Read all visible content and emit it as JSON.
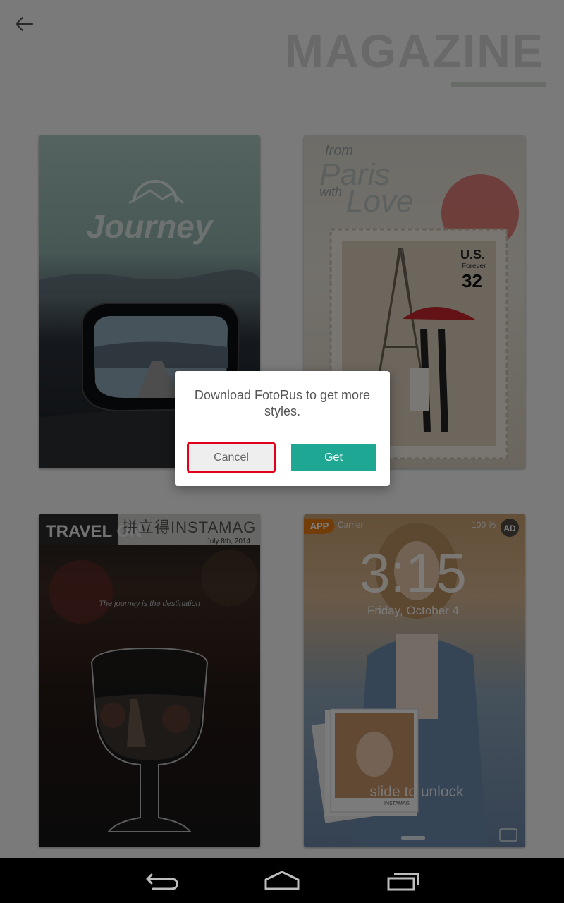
{
  "header": {
    "title": "MAGAZINE",
    "back_icon": "arrow-left-icon"
  },
  "templates": {
    "journey": {
      "title": "Journey"
    },
    "paris": {
      "from": "from",
      "paris": "Paris",
      "with": "with",
      "love": "Love",
      "stamp_country": "U.S.",
      "stamp_forever": "Forever",
      "stamp_value": "32"
    },
    "travel": {
      "title": "TRAVEL ON",
      "brand": "拼立得INSTAMAG",
      "date": "July 8th, 2014",
      "tagline": "The journey is the destination"
    },
    "lockscreen": {
      "app_badge": "APP",
      "carrier": "Carrier",
      "battery": "100 %",
      "ad_badge": "AD",
      "time": "3:15",
      "date": "Friday, October 4",
      "slide_text": "slide to unlock",
      "photo_caption": "— INSTAMAG"
    }
  },
  "dialog": {
    "message": "Download FotoRus to get more styles.",
    "cancel_label": "Cancel",
    "get_label": "Get"
  },
  "colors": {
    "accent": "#1ea793",
    "highlight": "#e0001a"
  },
  "navbar": {
    "icons": [
      "back-icon",
      "home-icon",
      "recent-apps-icon"
    ]
  }
}
